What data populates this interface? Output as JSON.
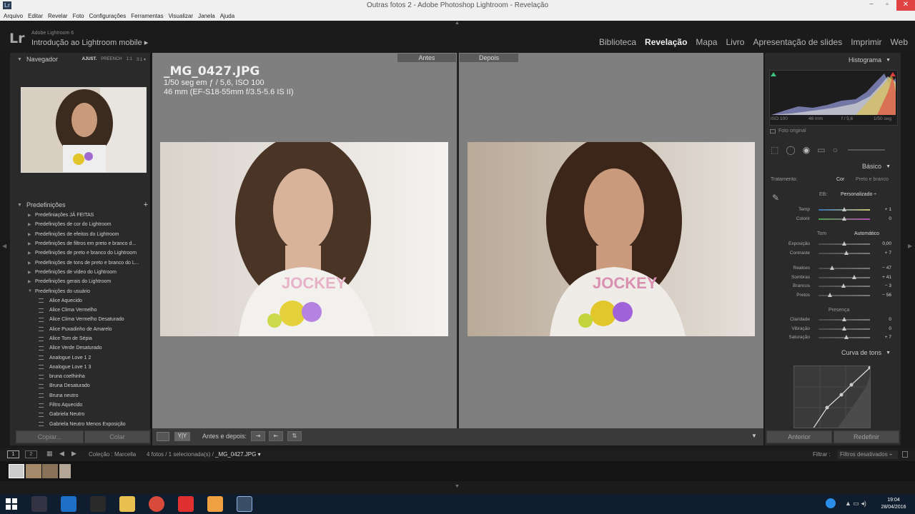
{
  "window": {
    "title": "Outras fotos 2 - Adobe Photoshop Lightroom - Revelação",
    "controls": [
      "−",
      "▫",
      "✕"
    ]
  },
  "menu": [
    "Arquivo",
    "Editar",
    "Revelar",
    "Foto",
    "Configurações",
    "Ferramentas",
    "Visualizar",
    "Janela",
    "Ajuda"
  ],
  "identity": {
    "logo": "Lr",
    "version": "Adobe Lightroom 6",
    "mobile": "Introdução ao Lightroom mobile ▸"
  },
  "modules": [
    {
      "label": "Biblioteca",
      "active": false
    },
    {
      "label": "Revelação",
      "active": true
    },
    {
      "label": "Mapa",
      "active": false
    },
    {
      "label": "Livro",
      "active": false
    },
    {
      "label": "Apresentação de slides",
      "active": false
    },
    {
      "label": "Imprimir",
      "active": false
    },
    {
      "label": "Web",
      "active": false
    }
  ],
  "navigator": {
    "title": "Navegador",
    "options": [
      "AJUST.",
      "PREENCH",
      "1:1",
      "3:1 ▾"
    ]
  },
  "presets": {
    "title": "Predefinições",
    "add": "+",
    "folders": [
      "Predefiniações JÁ FEITAS",
      "Predefinições de cor do Lightroom",
      "Predefinições de efeitos do Lightroom",
      "Predefinições de filtros em preto e branco d...",
      "Predefinições de preto e branco do Lightroom",
      "Predefinições de tons de preto e branco do L...",
      "Predefinições de vídeo do Lightroom",
      "Predefinições gerais do Lightroom",
      "Predefinições do usuário"
    ],
    "user_items": [
      "Alice Aquecido",
      "Alice Clima Vermelho",
      "Alice Clima Vermelho Desaturado",
      "Alice Puxadinho de Amarelo",
      "Alice Tom de Sépia",
      "Alice Verde Desaturado",
      "Analogue Love 1 2",
      "Analogue Love 1 3",
      "bruna coelhinha",
      "Bruna Desaturado",
      "Bruna neutro",
      "Filtro Aquecido",
      "Gabriela Neutro",
      "Gabriela Neutro Menos Exposição"
    ]
  },
  "left_buttons": {
    "copy": "Copiar...",
    "paste": "Colar"
  },
  "view": {
    "before_label": "Antes",
    "after_label": "Depois",
    "filename": "_MG_0427.JPG",
    "exposure": "1/50 seg em ƒ / 5,6, ISO 100",
    "lens": "46 mm (EF-S18-55mm f/3.5-5.6 IS II)"
  },
  "toolbar": {
    "before_after": "Antes e depois:",
    "yy": "Y|Y"
  },
  "histogram": {
    "title": "Histograma",
    "iso": "ISO 100",
    "focal": "46 mm",
    "aperture": "f / 5,6",
    "shutter": "1/50 seg",
    "original": "Foto original"
  },
  "basic": {
    "title": "Básico",
    "treatment_label": "Tratamento:",
    "treatment_color": "Cor",
    "treatment_bw": "Preto e branco",
    "wb_label": "EB:",
    "wb_value": "Personalizado ÷",
    "tone_label": "Tom",
    "auto_label": "Automático",
    "presence_label": "Presença",
    "sliders": [
      {
        "label": "Temp",
        "value": "+ 1",
        "pos": 0.5
      },
      {
        "label": "Colorir",
        "value": "0",
        "pos": 0.5
      },
      {
        "label": "Exposição",
        "value": "0,00",
        "pos": 0.5
      },
      {
        "label": "Contraste",
        "value": "+ 7",
        "pos": 0.54
      },
      {
        "label": "Realces",
        "value": "− 47",
        "pos": 0.27
      },
      {
        "label": "Sombras",
        "value": "+ 41",
        "pos": 0.7
      },
      {
        "label": "Brancos",
        "value": "− 3",
        "pos": 0.48
      },
      {
        "label": "Pretos",
        "value": "− 56",
        "pos": 0.22
      },
      {
        "label": "Claridade",
        "value": "0",
        "pos": 0.5
      },
      {
        "label": "Vibração",
        "value": "0",
        "pos": 0.5
      },
      {
        "label": "Saturação",
        "value": "+ 7",
        "pos": 0.54
      }
    ]
  },
  "tone_curve": {
    "title": "Curva de tons"
  },
  "right_buttons": {
    "previous": "Anterior",
    "reset": "Redefinir"
  },
  "filmbar": {
    "collection": "Coleção : Marcella",
    "count": "4 fotos / 1 selecionada(s) /",
    "file": "_MG_0427.JPG ▾",
    "filter_label": "Filtrar :",
    "filter_value": "Filtros desativados ÷",
    "pages": [
      "1",
      "2"
    ]
  },
  "taskbar": {
    "time": "19:04",
    "date": "28/04/2016"
  }
}
